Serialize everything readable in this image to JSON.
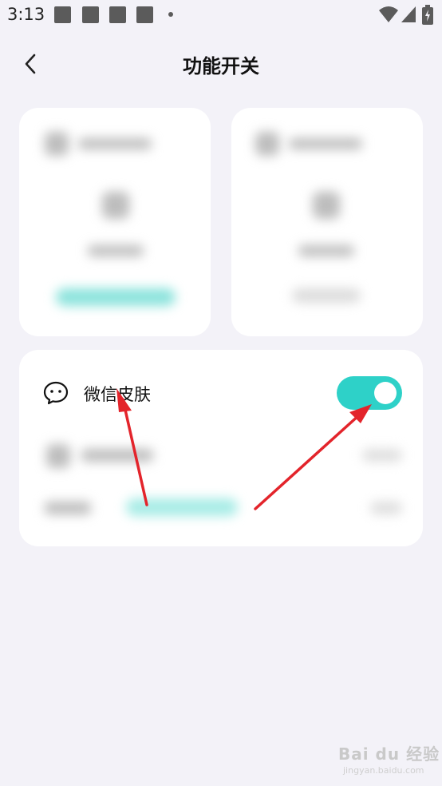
{
  "status_bar": {
    "time": "3:13",
    "notification_icons": [
      "app-notification-icon",
      "app-notification-icon",
      "app-notification-icon",
      "app-notification-icon"
    ],
    "system_icons": [
      "wifi-icon",
      "signal-icon",
      "battery-charging-icon"
    ]
  },
  "header": {
    "back_icon": "chevron-left-icon",
    "title": "功能开关"
  },
  "settings": {
    "wechat_skin": {
      "icon": "wechat-icon",
      "label": "微信皮肤",
      "enabled": true
    }
  },
  "colors": {
    "background": "#f3f2f8",
    "accent": "#2ed1c8",
    "annotation_arrow": "#e3242b"
  },
  "watermark": {
    "brand": "Bai du 经验",
    "sub": "jingyan.baidu.com"
  }
}
